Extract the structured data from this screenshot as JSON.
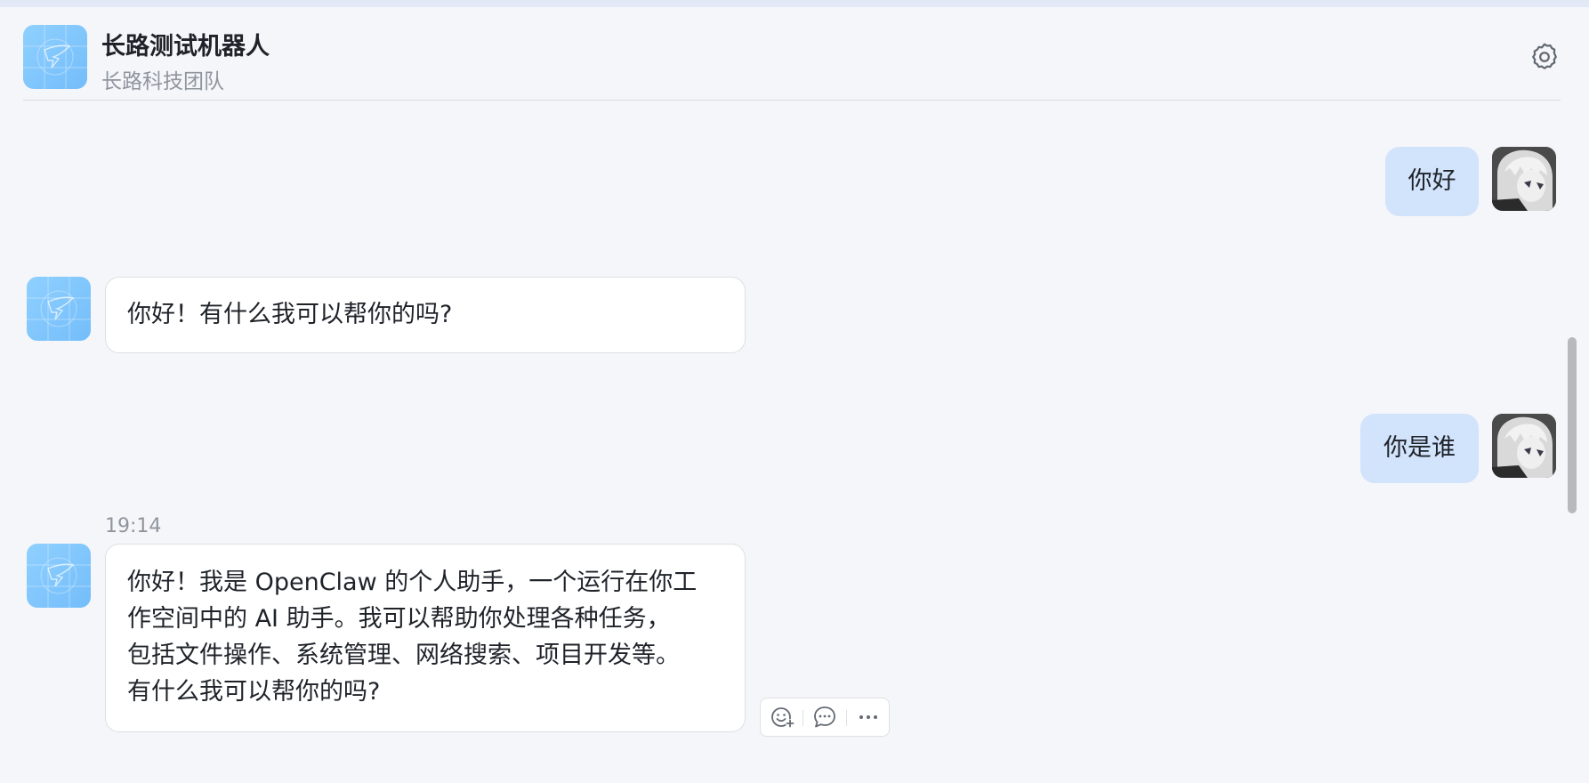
{
  "header": {
    "title": "长路测试机器人",
    "subtitle": "长路科技团队",
    "settings_icon": "gear-icon"
  },
  "messages": [
    {
      "sender": "user",
      "text": "你好"
    },
    {
      "sender": "bot",
      "text": "你好！有什么我可以帮你的吗?"
    },
    {
      "sender": "user",
      "text": "你是谁"
    },
    {
      "sender": "bot",
      "timestamp": "19:14",
      "lines": [
        "你好！我是 OpenClaw 的个人助手，一个运行在你工",
        "作空间中的 AI 助手。我可以帮助你处理各种任务，",
        "包括文件操作、系统管理、网络搜索、项目开发等。",
        "有什么我可以帮你的吗?"
      ]
    }
  ],
  "message_actions": {
    "icons": [
      "add-reaction-icon",
      "reply-icon",
      "more-icon"
    ]
  },
  "colors": {
    "background": "#f5f6fa",
    "user_bubble": "#d2e3fc",
    "bot_bubble": "#ffffff",
    "bot_avatar": "#8fd0ff"
  }
}
